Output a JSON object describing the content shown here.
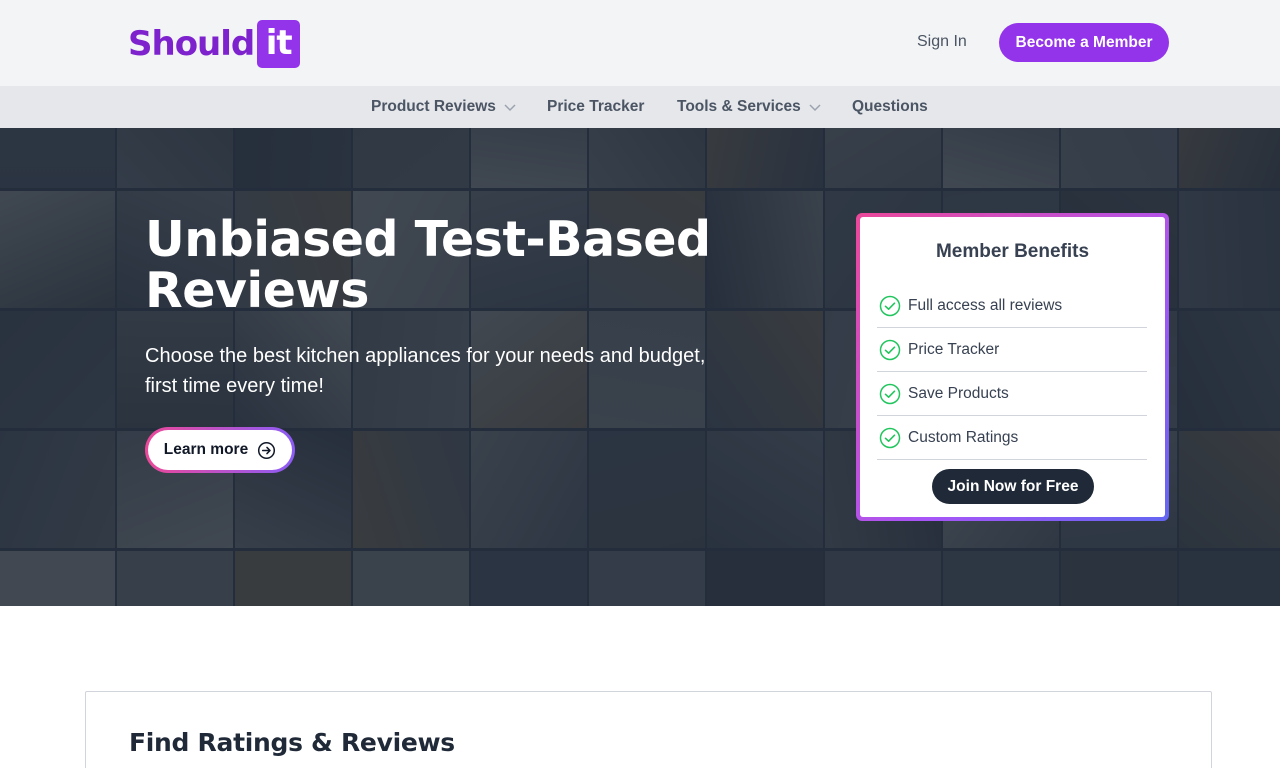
{
  "brand": {
    "logo_main": "Should",
    "logo_box": "it",
    "brand_color": "#9333ea"
  },
  "header": {
    "sign_in": "Sign In",
    "member_button": "Become a Member"
  },
  "nav": {
    "items": [
      {
        "label": "Product Reviews",
        "has_dropdown": true,
        "icon": "chevron-down-icon"
      },
      {
        "label": "Price Tracker",
        "has_dropdown": false
      },
      {
        "label": "Tools & Services",
        "has_dropdown": true,
        "icon": "chevron-down-icon"
      },
      {
        "label": "Questions",
        "has_dropdown": false
      }
    ]
  },
  "hero": {
    "title": "Unbiased Test-Based Reviews",
    "subtitle": "Choose the best kitchen appliances for your needs and budget, first time every time!",
    "cta_label": "Learn more",
    "cta_icon": "arrow-right-circle-icon"
  },
  "benefits": {
    "title": "Member Benefits",
    "items": [
      {
        "label": "Full access all reviews",
        "icon": "check-circle-icon"
      },
      {
        "label": "Price Tracker",
        "icon": "check-circle-icon"
      },
      {
        "label": "Save Products",
        "icon": "check-circle-icon"
      },
      {
        "label": "Custom Ratings",
        "icon": "check-circle-icon"
      }
    ],
    "join_button": "Join Now for Free",
    "check_color": "#22c55e",
    "border_gradient": [
      "#ec4899",
      "#a855f7",
      "#6366f1"
    ]
  },
  "find": {
    "title": "Find Ratings & Reviews"
  }
}
